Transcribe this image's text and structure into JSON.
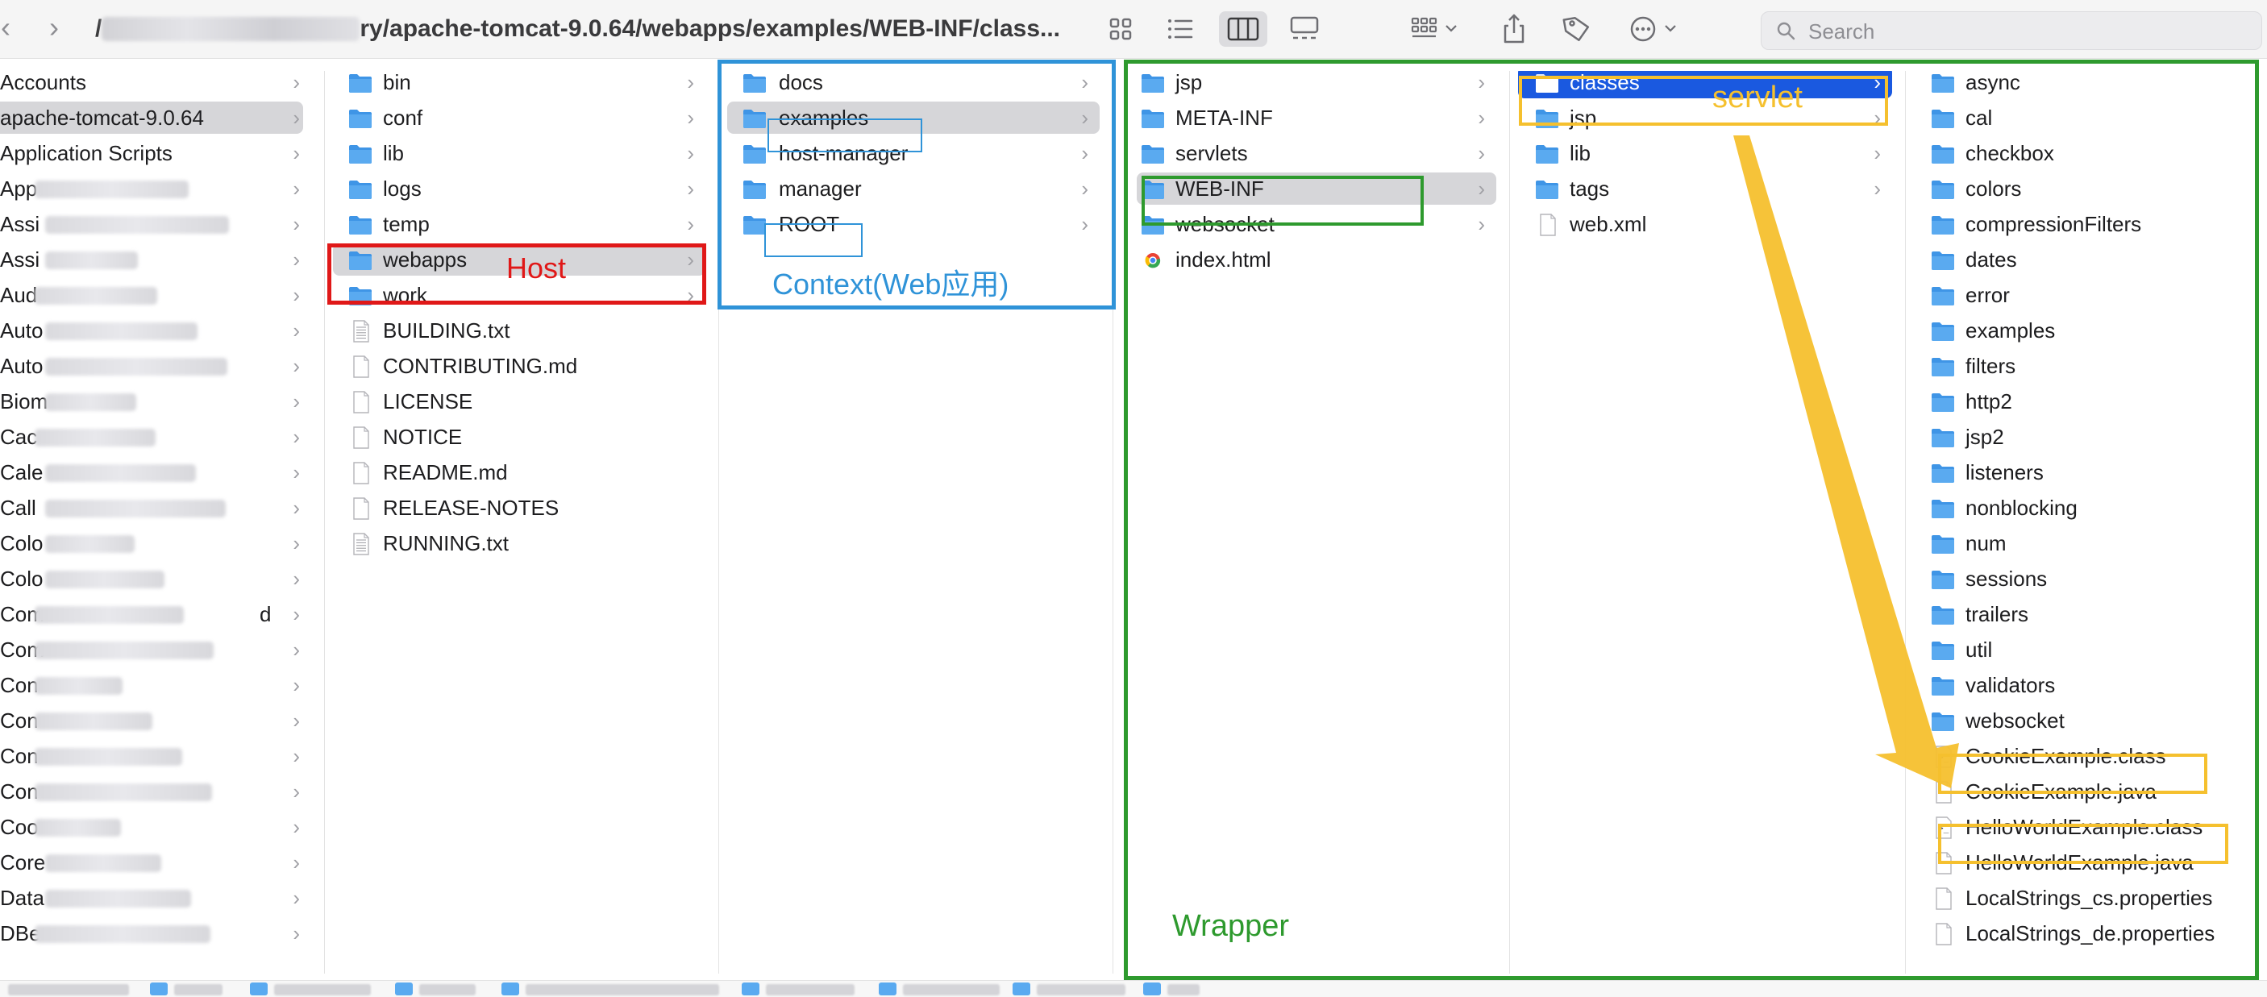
{
  "toolbar": {
    "path_visible": "ry/apache-tomcat-9.0.64/webapps/examples/WEB-INF/class...",
    "path_prefix": "/",
    "search_placeholder": "Search",
    "icons": [
      "chevron-left-icon",
      "chevron-right-icon",
      "icon-view-icon",
      "list-view-icon",
      "column-view-icon",
      "gallery-view-icon",
      "group-icon",
      "share-icon",
      "tag-icon",
      "more-icon",
      "search-icon"
    ]
  },
  "columns": {
    "col1": [
      {
        "label": "Accounts"
      },
      {
        "label": "apache-tomcat-9.0.64",
        "selected": true
      },
      {
        "label": "Application Scripts"
      },
      {
        "label": "App"
      },
      {
        "label": "Assi"
      },
      {
        "label": "Assi"
      },
      {
        "label": "Aud"
      },
      {
        "label": "Auto"
      },
      {
        "label": "Auto"
      },
      {
        "label": "Biom"
      },
      {
        "label": "Cac"
      },
      {
        "label": "Cale"
      },
      {
        "label": "Call"
      },
      {
        "label": "Colo"
      },
      {
        "label": "Colo"
      },
      {
        "label": "Com",
        "suffix": "d"
      },
      {
        "label": "Com"
      },
      {
        "label": "Con"
      },
      {
        "label": "Con"
      },
      {
        "label": "Con"
      },
      {
        "label": "Con"
      },
      {
        "label": "Coo"
      },
      {
        "label": "Core"
      },
      {
        "label": "Data"
      },
      {
        "label": "DBe"
      }
    ],
    "col2": [
      {
        "label": "bin",
        "type": "folder"
      },
      {
        "label": "conf",
        "type": "folder"
      },
      {
        "label": "lib",
        "type": "folder"
      },
      {
        "label": "logs",
        "type": "folder"
      },
      {
        "label": "temp",
        "type": "folder"
      },
      {
        "label": "webapps",
        "type": "folder",
        "selected": true
      },
      {
        "label": "work",
        "type": "folder"
      },
      {
        "label": "BUILDING.txt",
        "type": "text"
      },
      {
        "label": "CONTRIBUTING.md",
        "type": "doc"
      },
      {
        "label": "LICENSE",
        "type": "doc"
      },
      {
        "label": "NOTICE",
        "type": "doc"
      },
      {
        "label": "README.md",
        "type": "doc"
      },
      {
        "label": "RELEASE-NOTES",
        "type": "doc"
      },
      {
        "label": "RUNNING.txt",
        "type": "text"
      }
    ],
    "col3": [
      {
        "label": "docs",
        "type": "folder"
      },
      {
        "label": "examples",
        "type": "folder",
        "selected": true
      },
      {
        "label": "host-manager",
        "type": "folder"
      },
      {
        "label": "manager",
        "type": "folder"
      },
      {
        "label": "ROOT",
        "type": "folder"
      }
    ],
    "col4": [
      {
        "label": "jsp",
        "type": "folder"
      },
      {
        "label": "META-INF",
        "type": "folder"
      },
      {
        "label": "servlets",
        "type": "folder"
      },
      {
        "label": "WEB-INF",
        "type": "folder",
        "selected": true
      },
      {
        "label": "websocket",
        "type": "folder"
      },
      {
        "label": "index.html",
        "type": "html"
      }
    ],
    "col5": [
      {
        "label": "classes",
        "type": "folder",
        "selected": true,
        "active": true
      },
      {
        "label": "jsp",
        "type": "folder"
      },
      {
        "label": "lib",
        "type": "folder"
      },
      {
        "label": "tags",
        "type": "folder"
      },
      {
        "label": "web.xml",
        "type": "doc"
      }
    ],
    "col6": [
      {
        "label": "async",
        "type": "folder"
      },
      {
        "label": "cal",
        "type": "folder"
      },
      {
        "label": "checkbox",
        "type": "folder"
      },
      {
        "label": "colors",
        "type": "folder"
      },
      {
        "label": "compressionFilters",
        "type": "folder"
      },
      {
        "label": "dates",
        "type": "folder"
      },
      {
        "label": "error",
        "type": "folder"
      },
      {
        "label": "examples",
        "type": "folder"
      },
      {
        "label": "filters",
        "type": "folder"
      },
      {
        "label": "http2",
        "type": "folder"
      },
      {
        "label": "jsp2",
        "type": "folder"
      },
      {
        "label": "listeners",
        "type": "folder"
      },
      {
        "label": "nonblocking",
        "type": "folder"
      },
      {
        "label": "num",
        "type": "folder"
      },
      {
        "label": "sessions",
        "type": "folder"
      },
      {
        "label": "trailers",
        "type": "folder"
      },
      {
        "label": "util",
        "type": "folder"
      },
      {
        "label": "validators",
        "type": "folder"
      },
      {
        "label": "websocket",
        "type": "folder"
      },
      {
        "label": "CookieExample.class",
        "type": "class"
      },
      {
        "label": "CookieExample.java",
        "type": "doc"
      },
      {
        "label": "HelloWorldExample.class",
        "type": "class"
      },
      {
        "label": "HelloWorldExample.java",
        "type": "doc"
      },
      {
        "label": "LocalStrings_cs.properties",
        "type": "doc"
      },
      {
        "label": "LocalStrings_de.properties",
        "type": "doc"
      }
    ]
  },
  "annotations": {
    "host": "Host",
    "context": "Context(Web应用)",
    "wrapper": "Wrapper",
    "servlet": "servlet"
  },
  "colors": {
    "folder": "#5aaaf0",
    "selection_gray": "#d6d6d9",
    "selection_blue": "#1a59e0",
    "host_red": "#e01818",
    "context_blue": "#2f93d8",
    "wrapper_green": "#2e9a2e",
    "servlet_yellow": "#f5c02e"
  }
}
